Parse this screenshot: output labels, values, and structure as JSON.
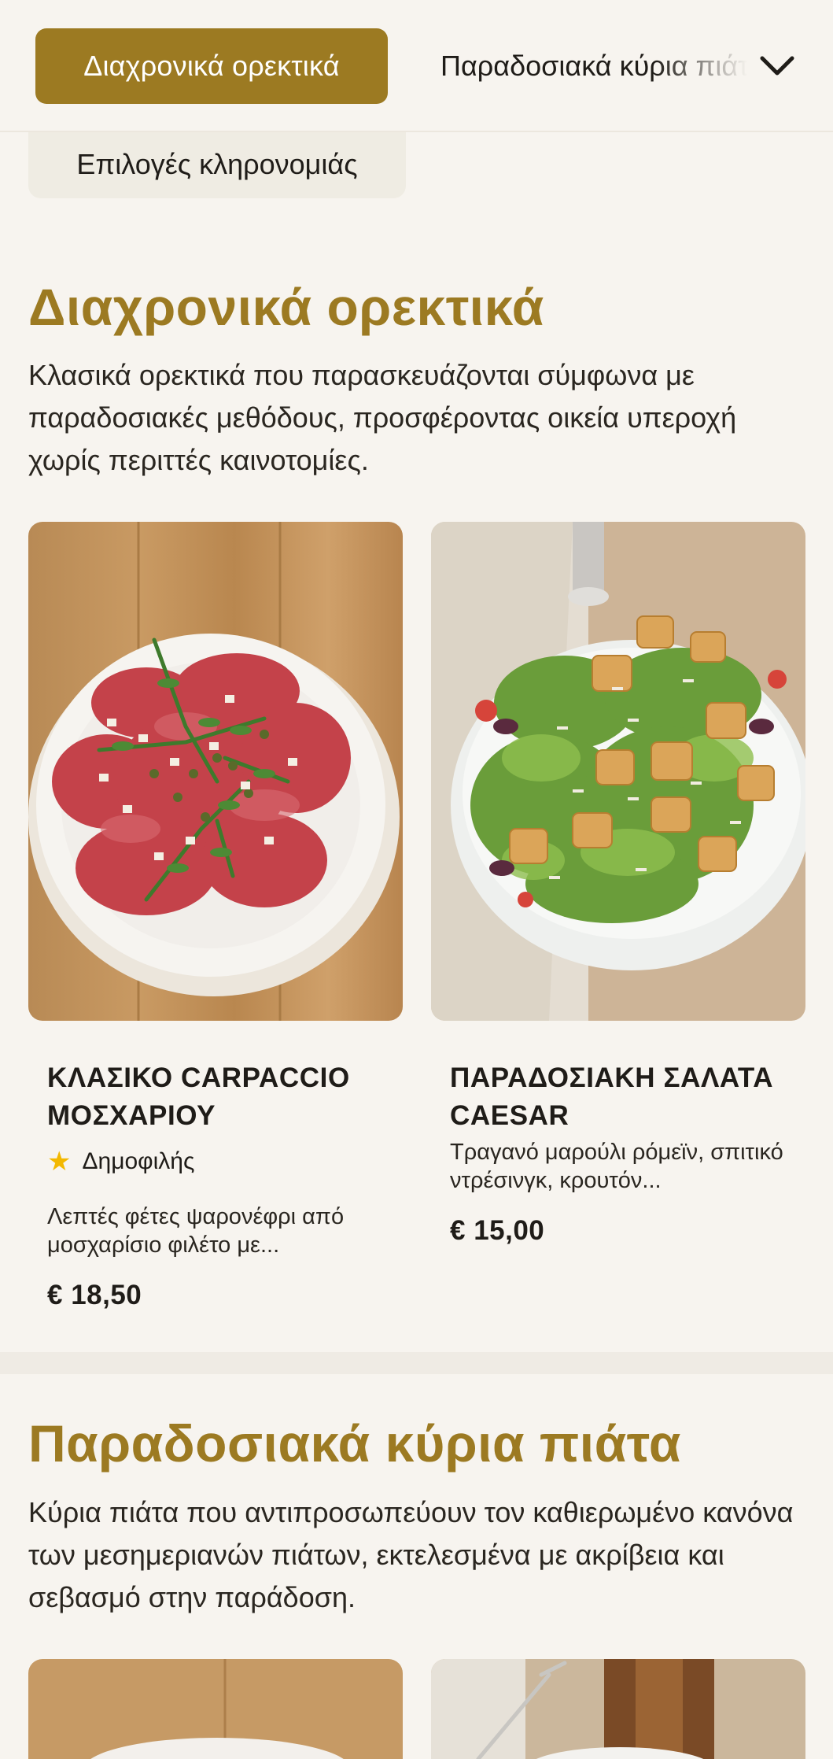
{
  "nav": {
    "active_category": "Διαχρονικά ορεκτικά",
    "next_category": "Παραδοσιακά κύρια πιάτα",
    "heritage_category": "Επιλογές κληρονομιάς"
  },
  "sections": [
    {
      "title": "Διαχρονικά ορεκτικά",
      "description": "Κλασικά ορεκτικά που παρασκευάζονται σύμφωνα με παραδοσιακές μεθόδους, προσφέροντας οικεία υπεροχή χωρίς περιττές καινοτομίες.",
      "items": [
        {
          "name": "ΚΛΑΣΙΚΟ CARPACCIO ΜΟΣΧΑΡΙΟΥ",
          "badge": "Δημοφιλής",
          "description": "Λεπτές φέτες ψαρονέφρι από μοσχαρίσιο φιλέτο με...",
          "price": "€ 18,50"
        },
        {
          "name": "ΠΑΡΑΔΟΣΙΑΚΗ ΣΑΛΑΤΑ CAESAR",
          "description": "Τραγανό μαρούλι ρόμεϊν, σπιτικό ντρέσινγκ, κρουτόν...",
          "price": "€ 15,00"
        }
      ]
    },
    {
      "title": "Παραδοσιακά κύρια πιάτα",
      "description": "Κύρια πιάτα που αντιπροσωπεύουν τον καθιερωμένο κανόνα των μεσημεριανών πιάτων, εκτελεσμένα με ακρίβεια και σεβασμό στην παράδοση."
    }
  ],
  "colors": {
    "accent": "#9c7a22",
    "background": "#f7f4ef",
    "star": "#f3b800"
  },
  "icons": {
    "dropdown": "chevron-down-icon",
    "badge": "star-icon"
  }
}
